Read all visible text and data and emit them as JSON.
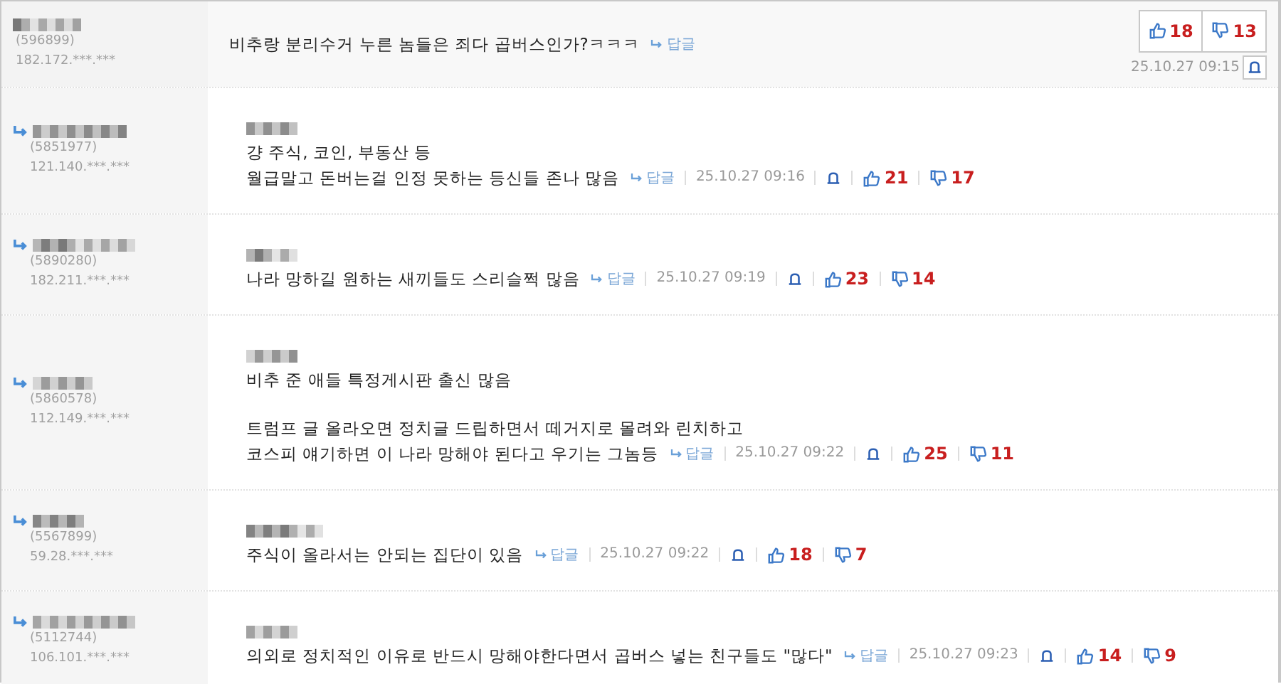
{
  "comments": [
    {
      "kind": "top",
      "member_id": "(596899)",
      "ip": "182.172.***.***",
      "paragraphs": [
        [
          "비추랑 분리수거 누른 놈들은 죄다 곱버스인가?ㅋㅋㅋ"
        ]
      ],
      "reply_label": "답글",
      "time": "25.10.27 09:15",
      "likes": "18",
      "dislikes": "13"
    },
    {
      "kind": "reply",
      "member_id": "(5851977)",
      "ip": "121.140.***.***",
      "paragraphs": [
        [
          "걍 주식, 코인, 부동산 등",
          "월급말고 돈버는걸 인정 못하는 등신들 존나 많음"
        ]
      ],
      "reply_label": "답글",
      "time": "25.10.27 09:16",
      "likes": "21",
      "dislikes": "17"
    },
    {
      "kind": "reply",
      "member_id": "(5890280)",
      "ip": "182.211.***.***",
      "paragraphs": [
        [
          "나라 망하길 원하는 새끼들도 스리슬쩍 많음"
        ]
      ],
      "reply_label": "답글",
      "time": "25.10.27 09:19",
      "likes": "23",
      "dislikes": "14"
    },
    {
      "kind": "reply",
      "member_id": "(5860578)",
      "ip": "112.149.***.***",
      "paragraphs": [
        [
          "비추 준 애들 특정게시판 출신 많음"
        ],
        [
          "트럼프 글 올라오면 정치글 드립하면서 떼거지로 몰려와 린치하고",
          "코스피 얘기하면 이 나라 망해야 된다고 우기는 그놈등"
        ]
      ],
      "reply_label": "답글",
      "time": "25.10.27 09:22",
      "likes": "25",
      "dislikes": "11"
    },
    {
      "kind": "reply",
      "member_id": "(5567899)",
      "ip": "59.28.***.***",
      "paragraphs": [
        [
          "주식이 올라서는 안되는 집단이 있음"
        ]
      ],
      "reply_label": "답글",
      "time": "25.10.27 09:22",
      "likes": "18",
      "dislikes": "7"
    },
    {
      "kind": "reply",
      "member_id": "(5112744)",
      "ip": "106.101.***.***",
      "paragraphs": [
        [
          "의외로 정치적인 이유로 반드시 망해야한다면서 곱버스 넣는 친구들도 \"많다\""
        ]
      ],
      "reply_label": "답글",
      "time": "25.10.27 09:23",
      "likes": "14",
      "dislikes": "9"
    }
  ]
}
